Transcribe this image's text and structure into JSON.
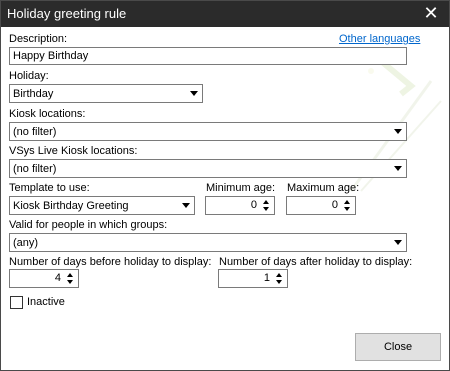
{
  "window": {
    "title": "Holiday greeting rule",
    "close_glyph": "✕"
  },
  "description": {
    "label": "Description:",
    "value": "Happy Birthday",
    "other_languages_link": "Other languages"
  },
  "holiday": {
    "label": "Holiday:",
    "value": "Birthday"
  },
  "kiosk_locations": {
    "label": "Kiosk locations:",
    "value": "(no filter)"
  },
  "vsys_locations": {
    "label": "VSys Live Kiosk locations:",
    "value": "(no filter)"
  },
  "template": {
    "label": "Template to use:",
    "value": "Kiosk Birthday Greeting"
  },
  "min_age": {
    "label": "Minimum age:",
    "value": "0"
  },
  "max_age": {
    "label": "Maximum age:",
    "value": "0"
  },
  "groups": {
    "label": "Valid for people in which groups:",
    "value": "(any)"
  },
  "days_before": {
    "label": "Number of days before holiday to display:",
    "value": "4"
  },
  "days_after": {
    "label": "Number of days after holiday to display:",
    "value": "1"
  },
  "inactive": {
    "label": "Inactive",
    "checked": false
  },
  "buttons": {
    "close": "Close"
  },
  "colors": {
    "titlebar": "#2b2b2b",
    "link": "#0066cc",
    "button": "#e1e1e1"
  }
}
